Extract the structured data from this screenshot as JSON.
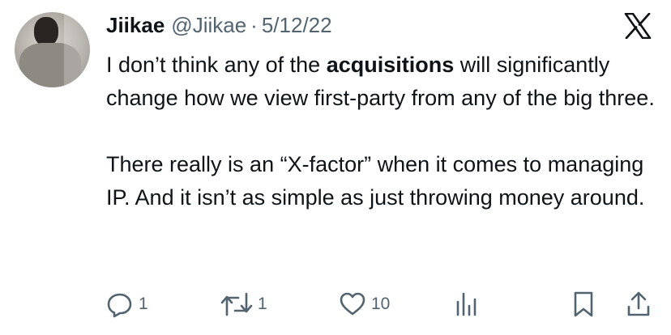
{
  "tweet": {
    "author_name": "Jiikae",
    "handle": "@Jiikae",
    "separator": "·",
    "date": "5/12/22",
    "paragraph1": {
      "before": "I don’t think any of the ",
      "bold": "acquisitions",
      "after": " will significantly change how we view first-party from any of the big three."
    },
    "paragraph2": "There really is an “X-factor” when it comes to managing IP. And it isn’t as simple as just throwing money around."
  },
  "metrics": {
    "replies": "1",
    "reposts": "1",
    "likes": "10"
  },
  "icons": {
    "logo": "x-logo-icon",
    "reply": "reply-icon",
    "repost": "repost-icon",
    "like": "heart-icon",
    "views": "views-icon",
    "bookmark": "bookmark-icon",
    "share": "share-icon"
  },
  "colors": {
    "text": "#0f1419",
    "secondary": "#536471",
    "icon": "#536471"
  }
}
